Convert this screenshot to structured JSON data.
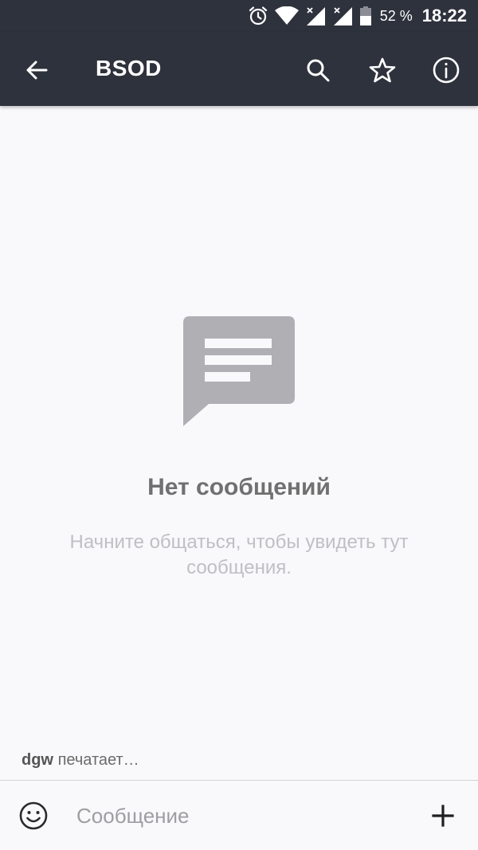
{
  "status_bar": {
    "battery_percent": "52 %",
    "time": "18:22",
    "icons": [
      "alarm-icon",
      "wifi-icon",
      "signal-icon",
      "signal-icon",
      "battery-icon"
    ]
  },
  "toolbar": {
    "title": "BSOD",
    "back_icon": "back-arrow-icon",
    "actions": [
      "search-icon",
      "star-icon",
      "info-icon"
    ]
  },
  "empty_state": {
    "icon": "message-icon",
    "heading": "Нет сообщений",
    "hint": "Начните общаться, чтобы увидеть тут сообщения."
  },
  "typing_indicator": {
    "user": "dgw",
    "text": "печатает…"
  },
  "composer": {
    "placeholder": "Сообщение",
    "value": "",
    "emoji_icon": "emoji-icon",
    "add_icon": "plus-icon"
  },
  "colors": {
    "bar": "#2e323d",
    "background": "#f9f8fa",
    "illustration": "#b0afb3",
    "heading": "#707070",
    "hint": "#c0bfc4"
  }
}
